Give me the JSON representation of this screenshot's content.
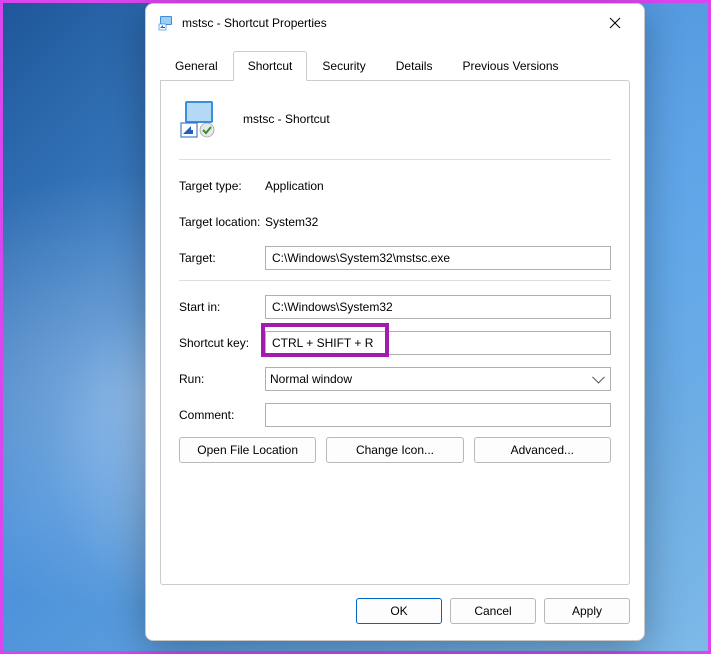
{
  "window": {
    "title": "mstsc - Shortcut Properties"
  },
  "tabs": {
    "general": "General",
    "shortcut": "Shortcut",
    "security": "Security",
    "details": "Details",
    "previous": "Previous Versions"
  },
  "header": {
    "name": "mstsc - Shortcut"
  },
  "fields": {
    "target_type_label": "Target type:",
    "target_type_value": "Application",
    "target_location_label": "Target location:",
    "target_location_value": "System32",
    "target_label": "Target:",
    "target_value": "C:\\Windows\\System32\\mstsc.exe",
    "start_in_label": "Start in:",
    "start_in_value": "C:\\Windows\\System32",
    "shortcut_key_label": "Shortcut key:",
    "shortcut_key_value": "CTRL + SHIFT + R",
    "run_label": "Run:",
    "run_value": "Normal window",
    "comment_label": "Comment:",
    "comment_value": ""
  },
  "buttons": {
    "open_file_location": "Open File Location",
    "change_icon": "Change Icon...",
    "advanced": "Advanced...",
    "ok": "OK",
    "cancel": "Cancel",
    "apply": "Apply"
  }
}
